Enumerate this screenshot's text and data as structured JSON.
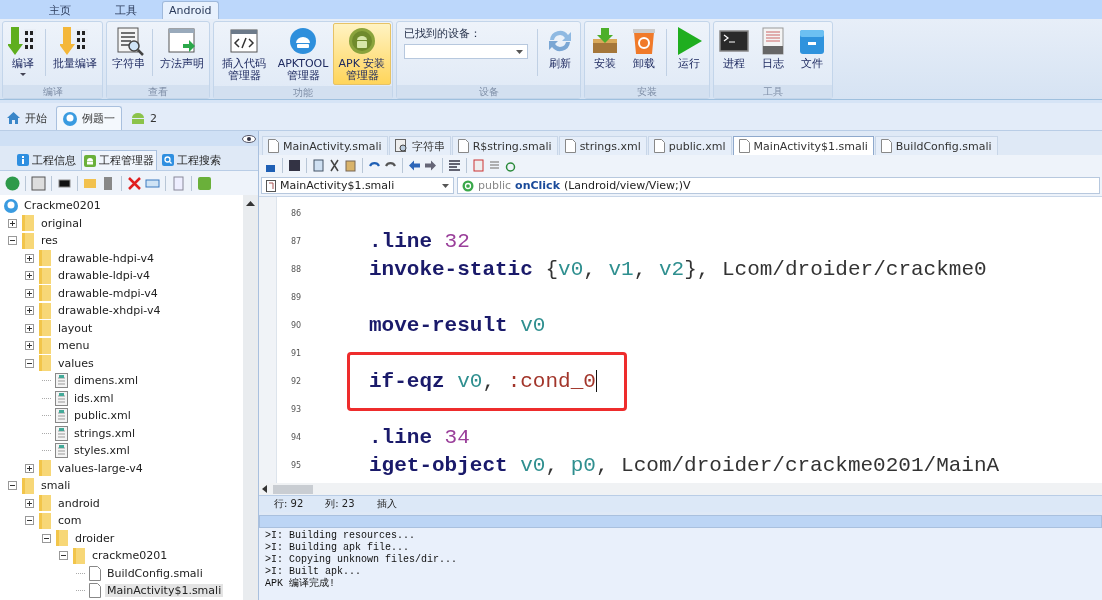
{
  "menu_tabs": [
    {
      "label": "主页",
      "selected": false
    },
    {
      "label": "工具",
      "selected": false
    },
    {
      "label": "Android",
      "selected": true
    }
  ],
  "ribbon": [
    {
      "title": "编译",
      "buttons": [
        {
          "label": "编译",
          "highlighted": false,
          "dropdown": true
        },
        {
          "label": "批量编译",
          "highlighted": false
        }
      ]
    },
    {
      "title": "查看",
      "buttons": [
        {
          "label": "字符串",
          "highlighted": false
        },
        {
          "label": "方法声明",
          "highlighted": false
        }
      ]
    },
    {
      "title": "功能",
      "buttons": [
        {
          "label": "插入代码管理器",
          "highlighted": false
        },
        {
          "label": "APKTOOL管理器",
          "highlighted": false
        },
        {
          "label": "APK 安装管理器",
          "highlighted": true
        }
      ]
    },
    {
      "title": "设备",
      "device_label": "已找到的设备：",
      "buttons": [
        {
          "label": "刷新",
          "highlighted": false
        }
      ]
    },
    {
      "title": "安装",
      "buttons": [
        {
          "label": "安装",
          "highlighted": false
        },
        {
          "label": "卸载",
          "highlighted": false
        },
        {
          "label": "运行",
          "highlighted": false
        }
      ]
    },
    {
      "title": "工具",
      "buttons": [
        {
          "label": "进程",
          "highlighted": false
        },
        {
          "label": "日志",
          "highlighted": false
        },
        {
          "label": "文件",
          "highlighted": false
        }
      ]
    }
  ],
  "doc_tabs": [
    {
      "label": "开始",
      "selected": false
    },
    {
      "label": "例题一",
      "selected": true
    },
    {
      "label": "2",
      "selected": false
    }
  ],
  "panel_tabs": [
    {
      "label": "工程信息",
      "selected": false
    },
    {
      "label": "工程管理器",
      "selected": true
    },
    {
      "label": "工程搜索",
      "selected": false
    }
  ],
  "tree": [
    {
      "label": "Crackme0201",
      "kind": "project",
      "selected": false,
      "children": [
        {
          "label": "original",
          "kind": "folder",
          "expanded": false,
          "selected": false
        },
        {
          "label": "res",
          "kind": "folder",
          "expanded": true,
          "selected": false,
          "children": [
            {
              "label": "drawable-hdpi-v4",
              "kind": "folder",
              "expanded": false,
              "selected": false
            },
            {
              "label": "drawable-ldpi-v4",
              "kind": "folder",
              "expanded": false,
              "selected": false
            },
            {
              "label": "drawable-mdpi-v4",
              "kind": "folder",
              "expanded": false,
              "selected": false
            },
            {
              "label": "drawable-xhdpi-v4",
              "kind": "folder",
              "expanded": false,
              "selected": false
            },
            {
              "label": "layout",
              "kind": "folder",
              "expanded": false,
              "selected": false
            },
            {
              "label": "menu",
              "kind": "folder",
              "expanded": false,
              "selected": false
            },
            {
              "label": "values",
              "kind": "folder",
              "expanded": true,
              "selected": false,
              "children": [
                {
                  "label": "dimens.xml",
                  "kind": "xml",
                  "selected": false
                },
                {
                  "label": "ids.xml",
                  "kind": "xml",
                  "selected": false
                },
                {
                  "label": "public.xml",
                  "kind": "xml",
                  "selected": false
                },
                {
                  "label": "strings.xml",
                  "kind": "xml",
                  "selected": false
                },
                {
                  "label": "styles.xml",
                  "kind": "xml",
                  "selected": false
                }
              ]
            },
            {
              "label": "values-large-v4",
              "kind": "folder",
              "expanded": false,
              "selected": false
            }
          ]
        },
        {
          "label": "smali",
          "kind": "folder",
          "expanded": true,
          "selected": false,
          "children": [
            {
              "label": "android",
              "kind": "folder",
              "expanded": false,
              "selected": false
            },
            {
              "label": "com",
              "kind": "folder",
              "expanded": true,
              "selected": false,
              "children": [
                {
                  "label": "droider",
                  "kind": "folder",
                  "expanded": true,
                  "selected": false,
                  "children": [
                    {
                      "label": "crackme0201",
                      "kind": "folder",
                      "expanded": true,
                      "selected": false,
                      "children": [
                        {
                          "label": "BuildConfig.smali",
                          "kind": "smali",
                          "selected": false
                        },
                        {
                          "label": "MainActivity$1.smali",
                          "kind": "smali",
                          "selected": true
                        }
                      ]
                    }
                  ]
                }
              ]
            }
          ]
        }
      ]
    }
  ],
  "file_tabs": [
    {
      "label": "MainActivity.smali",
      "kind": "file",
      "selected": false
    },
    {
      "label": "字符串",
      "kind": "strings",
      "selected": false
    },
    {
      "label": "R$string.smali",
      "kind": "file",
      "selected": false
    },
    {
      "label": "strings.xml",
      "kind": "file",
      "selected": false
    },
    {
      "label": "public.xml",
      "kind": "file",
      "selected": false
    },
    {
      "label": "MainActivity$1.smali",
      "kind": "file",
      "selected": true
    },
    {
      "label": "BuildConfig.smali",
      "kind": "file",
      "selected": false
    }
  ],
  "class_select": "MainActivity$1.smali",
  "method_select": {
    "modifier": "public",
    "name": "onClick",
    "signature": "(Landroid/view/View;)V"
  },
  "code_lines": [
    {
      "number": "86"
    },
    {
      "number": "87",
      "tokens": [
        {
          "kind": "kw",
          "text": ".line"
        },
        {
          "kind": "num",
          "text": " 32"
        }
      ]
    },
    {
      "number": "88",
      "tokens": [
        {
          "kind": "kw",
          "text": "invoke-static"
        },
        {
          "kind": "plain",
          "text": " {"
        },
        {
          "kind": "reg",
          "text": "v0"
        },
        {
          "kind": "plain",
          "text": ", "
        },
        {
          "kind": "reg",
          "text": "v1"
        },
        {
          "kind": "plain",
          "text": ", "
        },
        {
          "kind": "reg",
          "text": "v2"
        },
        {
          "kind": "plain",
          "text": "}, Lcom/droider/crackme0"
        }
      ]
    },
    {
      "number": "89"
    },
    {
      "number": "90",
      "tokens": [
        {
          "kind": "kw",
          "text": "move-result"
        },
        {
          "kind": "reg",
          "text": " v0"
        }
      ]
    },
    {
      "number": "91"
    },
    {
      "number": "92",
      "boxed": true,
      "cursor": true,
      "tokens": [
        {
          "kind": "kw",
          "text": "if-eqz"
        },
        {
          "kind": "reg",
          "text": " v0"
        },
        {
          "kind": "plain",
          "text": ", "
        },
        {
          "kind": "label",
          "text": ":cond_0"
        }
      ]
    },
    {
      "number": "93"
    },
    {
      "number": "94",
      "tokens": [
        {
          "kind": "kw",
          "text": ".line"
        },
        {
          "kind": "num",
          "text": " 34"
        }
      ]
    },
    {
      "number": "95",
      "tokens": [
        {
          "kind": "kw",
          "text": "iget-object"
        },
        {
          "kind": "reg",
          "text": " v0"
        },
        {
          "kind": "plain",
          "text": ", "
        },
        {
          "kind": "reg",
          "text": "p0"
        },
        {
          "kind": "plain",
          "text": ", Lcom/droider/crackme0201/MainA"
        }
      ]
    }
  ],
  "status_bar": {
    "line": "行: 92",
    "column": "列: 23",
    "mode": "插入"
  },
  "output": [
    ">I: Building resources...",
    ">I: Building apk file...",
    ">I: Copying unknown files/dir...",
    ">I: Built apk...",
    "APK 编译完成!"
  ]
}
